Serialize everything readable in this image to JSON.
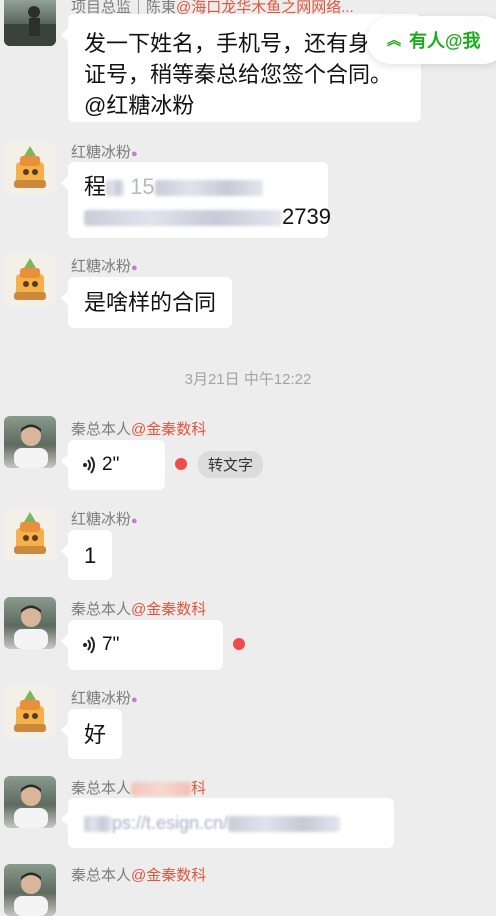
{
  "mention_bar": {
    "label": "有人@我",
    "color": "#1aad19"
  },
  "messages": [
    {
      "sender": "项目总监｜陈東",
      "mention": "@海口龙华木鱼之网网络...",
      "text": "发一下姓名，手机号，还有身份证号，稍等秦总给您签个合同。@红糖冰粉"
    },
    {
      "sender": "红糖冰粉",
      "line1_prefix": "程",
      "line1_partial": "15",
      "line2_suffix": "2739"
    },
    {
      "sender": "红糖冰粉",
      "text": "是啥样的合同"
    },
    {
      "timestamp": "3月21日 中午12:22"
    },
    {
      "sender": "秦总本人",
      "mention": "@金秦数科",
      "voice_duration": "2\"",
      "transcribe_label": "转文字"
    },
    {
      "sender": "红糖冰粉",
      "text": "1"
    },
    {
      "sender": "秦总本人",
      "mention": "@金秦数科",
      "voice_duration": "7\""
    },
    {
      "sender": "红糖冰粉",
      "text": "好"
    },
    {
      "sender": "秦总本人",
      "mention_tail": "科",
      "link_partial": "ps://t.esign.cn/"
    },
    {
      "sender": "秦总本人",
      "mention": "@金秦数科"
    }
  ],
  "colors": {
    "background": "#ededed",
    "bubble": "#ffffff",
    "mention": "#e0553d",
    "unread_dot": "#f04b4b"
  }
}
